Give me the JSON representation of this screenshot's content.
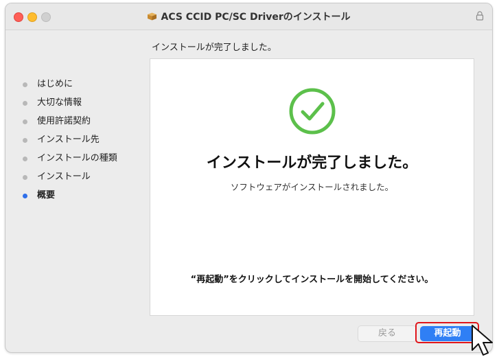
{
  "window": {
    "title": "ACS CCID PC/SC Driverのインストール",
    "icons": [
      "package-icon",
      "lock-icon"
    ]
  },
  "header": {
    "heading": "インストールが完了しました。"
  },
  "sidebar": {
    "items": [
      {
        "label": "はじめに",
        "active": false
      },
      {
        "label": "大切な情報",
        "active": false
      },
      {
        "label": "使用許諾契約",
        "active": false
      },
      {
        "label": "インストール先",
        "active": false
      },
      {
        "label": "インストールの種類",
        "active": false
      },
      {
        "label": "インストール",
        "active": false
      },
      {
        "label": "概要",
        "active": true
      }
    ]
  },
  "content": {
    "icon": "checkmark-circle-icon",
    "title": "インストールが完了しました。",
    "subtitle": "ソフトウェアがインストールされました。",
    "instruction": "“再起動”をクリックしてインストールを開始してください。"
  },
  "buttons": {
    "back_label": "戻る",
    "restart_label": "再起動"
  },
  "colors": {
    "accent": "#2f7ff5",
    "success": "#5cc04b",
    "highlight": "#e0141a",
    "active_dot": "#2f6fea"
  }
}
